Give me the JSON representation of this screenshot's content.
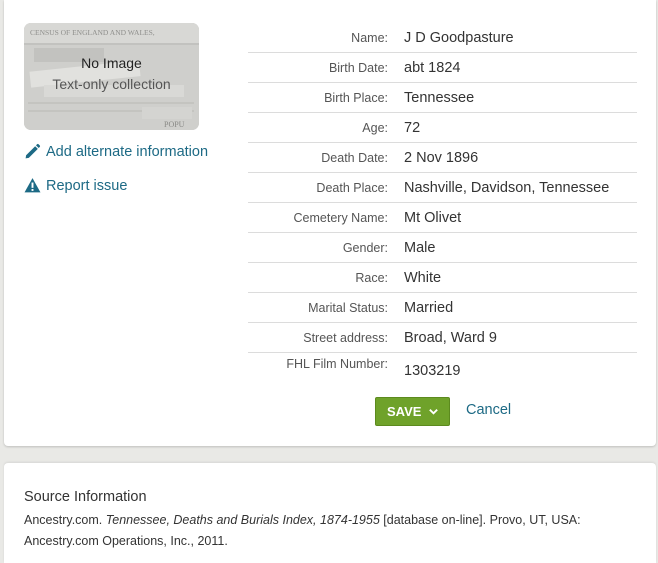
{
  "thumbnail": {
    "title": "No Image",
    "subtitle": "Text-only collection",
    "bg_doc_text": "CENSUS OF ENGLAND AND WALES,",
    "bg_doc_text2": "POPU"
  },
  "actions": {
    "add_alternate": "Add alternate information",
    "report_issue": "Report issue"
  },
  "record": [
    {
      "label": "Name:",
      "value": "J D Goodpasture"
    },
    {
      "label": "Birth Date:",
      "value": "abt 1824"
    },
    {
      "label": "Birth Place:",
      "value": "Tennessee"
    },
    {
      "label": "Age:",
      "value": "72"
    },
    {
      "label": "Death Date:",
      "value": "2 Nov 1896"
    },
    {
      "label": "Death Place:",
      "value": "Nashville, Davidson, Tennessee"
    },
    {
      "label": "Cemetery Name:",
      "value": "Mt Olivet"
    },
    {
      "label": "Gender:",
      "value": "Male"
    },
    {
      "label": "Race:",
      "value": "White"
    },
    {
      "label": "Marital Status:",
      "value": "Married"
    },
    {
      "label": "Street address:",
      "value": "Broad, Ward 9"
    },
    {
      "label": "FHL Film Number:",
      "value": "1303219"
    }
  ],
  "buttons": {
    "save": "SAVE",
    "cancel": "Cancel"
  },
  "source": {
    "heading": "Source Information",
    "publisher": "Ancestry.com.",
    "title": "Tennessee, Deaths and Burials Index, 1874-1955",
    "rest": "[database on-line]. Provo, UT, USA: Ancestry.com Operations, Inc., 2011."
  },
  "colors": {
    "link": "#1d6a85",
    "save_button": "#6fa22a",
    "page_bg": "#e9e9e6"
  },
  "icons": {
    "add_alternate": "pencil-icon",
    "report_issue": "warning-triangle-icon",
    "save_dropdown": "chevron-down-icon"
  }
}
